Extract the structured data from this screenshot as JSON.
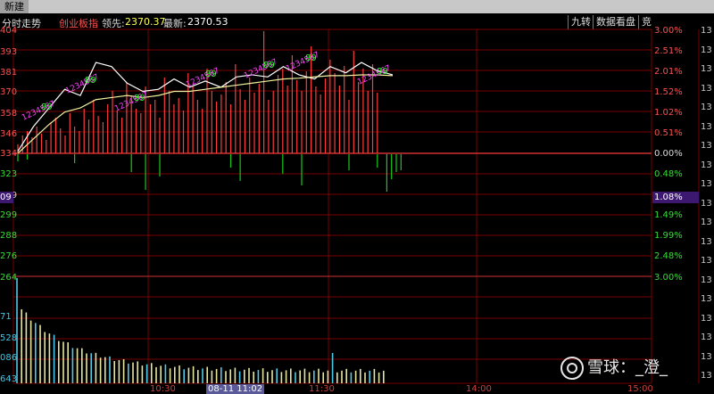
{
  "window": {
    "tab_label": "新建"
  },
  "header": {
    "mode": "分时走势",
    "index_name": "创业板指",
    "lead_label": "领先:",
    "lead_value": "2370.37",
    "latest_label": "最新:",
    "latest_value": "2370.53"
  },
  "buttons": {
    "nine_turn": "九转",
    "data_view": "数据看盘",
    "bid": "竞"
  },
  "colors": {
    "up": "#ff3b3b",
    "down": "#19c819",
    "white_line": "#ffffff",
    "lead_line": "#f0f0a0",
    "grid": "#7a0000",
    "volume": "#e6e6a0",
    "volume_alt": "#50c8e6"
  },
  "axes": {
    "left_price_labels": [
      "404",
      "393",
      "381",
      "370",
      "358",
      "346",
      "334",
      "323",
      "309",
      "299",
      "288",
      "276",
      "264"
    ],
    "left_volume_labels": [
      "71",
      "528",
      "086",
      "643"
    ],
    "pct_labels": [
      "3.00%",
      "2.51%",
      "2.01%",
      "1.52%",
      "1.02%",
      "0.51%",
      "0.00%",
      "0.48%",
      "1.08%",
      "1.49%",
      "1.99%",
      "2.48%",
      "3.00%"
    ],
    "far_right_labels": [
      "13",
      "13",
      "13",
      "13",
      "13",
      "13",
      "13",
      "13",
      "13",
      "13",
      "13",
      "13",
      "13",
      "13",
      "13",
      "13",
      "13",
      "13",
      "13"
    ],
    "x_labels": [
      "10:30",
      "11:30",
      "14:00",
      "15:00"
    ],
    "cursor_x_label": "08-11 11:02",
    "cursor_y_pct": "1.08%",
    "cursor_y_left": "09"
  },
  "markers": [
    {
      "text": "1234567",
      "color": "#ff44ff"
    },
    {
      "text": "89",
      "color": "#33ff33"
    }
  ],
  "watermark": {
    "text": "雪球：_澄_"
  },
  "chart_data": {
    "type": "line",
    "x": [
      0,
      10,
      20,
      30,
      40,
      50,
      60,
      70,
      80,
      90,
      100,
      110,
      120,
      130,
      140,
      150,
      160,
      170,
      180,
      190,
      200,
      210,
      220,
      230,
      240
    ],
    "series": [
      {
        "values": [
          0.05,
          0.65,
          1.1,
          1.55,
          1.4,
          2.2,
          2.1,
          1.7,
          1.5,
          1.55,
          1.8,
          1.6,
          1.75,
          1.6,
          1.85,
          1.9,
          1.85,
          2.1,
          1.9,
          1.8,
          2.1,
          1.95,
          2.2,
          2.0,
          1.9
        ]
      },
      {
        "values": [
          0.0,
          0.35,
          0.7,
          1.0,
          1.1,
          1.3,
          1.35,
          1.4,
          1.35,
          1.4,
          1.5,
          1.5,
          1.55,
          1.6,
          1.65,
          1.7,
          1.75,
          1.8,
          1.82,
          1.85,
          1.88,
          1.88,
          1.9,
          1.9,
          1.88
        ]
      }
    ],
    "ylim": [
      -3.0,
      3.0
    ]
  }
}
